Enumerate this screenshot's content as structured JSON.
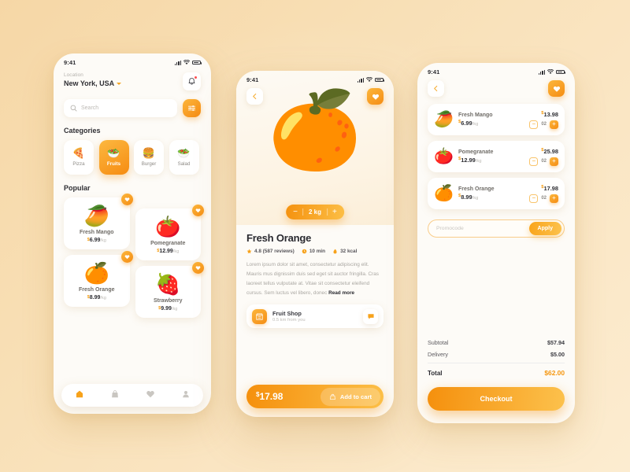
{
  "background": {
    "accent": "#f5960f",
    "page_bg": "#f8dfb5"
  },
  "status_bar": {
    "time": "9:41"
  },
  "home": {
    "location_label": "Location",
    "city": "New York, USA",
    "notification_icon": "bell-icon",
    "search": {
      "placeholder": "Search",
      "icon": "search-icon"
    },
    "filter_icon": "filter-icon",
    "categories_title": "Categories",
    "categories": [
      {
        "label": "Pizza",
        "emoji": "🍕",
        "active": false
      },
      {
        "label": "Fruits",
        "emoji": "🥗",
        "active": true
      },
      {
        "label": "Burger",
        "emoji": "🍔",
        "active": false
      },
      {
        "label": "Salad",
        "emoji": "🥗",
        "active": false
      }
    ],
    "popular_title": "Popular",
    "products": [
      {
        "name": "Fresh Mango",
        "price": "6.99",
        "currency": "$",
        "unit": "/kg",
        "emoji": "🥭"
      },
      {
        "name": "Pomegranate",
        "price": "12.99",
        "currency": "$",
        "unit": "/kg",
        "emoji": "🍅"
      },
      {
        "name": "Fresh Orange",
        "price": "8.99",
        "currency": "$",
        "unit": "/kg",
        "emoji": "🍊"
      },
      {
        "name": "Strawberry",
        "price": "9.99",
        "currency": "$",
        "unit": "/kg",
        "emoji": "🍓"
      }
    ],
    "tabs": [
      {
        "name": "home",
        "icon": "home-icon",
        "active": true
      },
      {
        "name": "bag",
        "icon": "bag-icon",
        "active": false
      },
      {
        "name": "favorites",
        "icon": "heart-icon",
        "active": false
      },
      {
        "name": "profile",
        "icon": "person-icon",
        "active": false
      }
    ]
  },
  "detail": {
    "back_icon": "chevron-left-icon",
    "favorite_icon": "heart-icon",
    "hero_emoji": "🍊",
    "quantity": {
      "minus": "−",
      "value": "2 kg",
      "plus": "+"
    },
    "title": "Fresh Orange",
    "meta": [
      {
        "icon": "star-icon",
        "text": "4.8 (587 reviews)"
      },
      {
        "icon": "clock-icon",
        "text": "10 min"
      },
      {
        "icon": "flame-icon",
        "text": "32 kcal"
      }
    ],
    "description": "Lorem ipsum dolor sit amet, consectetur adipiscing elit. Mauris mus dignissim duis sed eget sit auctor fringilla. Cras laoreet tellus vulputate at. Vitae sit consectetur eleifend cursus. Sem luctus vel libero, donec ",
    "read_more": "Read more",
    "shop": {
      "name": "Fruit Shop",
      "distance": "0.5 km from you",
      "icon": "store-icon",
      "chat_icon": "chat-icon"
    },
    "cta": {
      "currency": "$",
      "price": "17.98",
      "label": "Add to cart",
      "icon": "bag-icon"
    }
  },
  "cart": {
    "back_icon": "chevron-left-icon",
    "favorite_icon": "heart-icon",
    "items": [
      {
        "name": "Fresh Mango",
        "unit_price": "6.99",
        "unit": "/kg",
        "currency": "$",
        "total": "13.98",
        "qty": "02",
        "emoji": "🥭"
      },
      {
        "name": "Pomegranate",
        "unit_price": "12.99",
        "unit": "/kg",
        "currency": "$",
        "total": "25.98",
        "qty": "02",
        "emoji": "🍅"
      },
      {
        "name": "Fresh Orange",
        "unit_price": "8.99",
        "unit": "/kg",
        "currency": "$",
        "total": "17.98",
        "qty": "02",
        "emoji": "🍊"
      }
    ],
    "promocode": {
      "placeholder": "Promocode",
      "apply_label": "Apply"
    },
    "summary": {
      "subtotal_label": "Subtotal",
      "subtotal_value": "$57.94",
      "delivery_label": "Delivery",
      "delivery_value": "$5.00",
      "total_label": "Total",
      "total_value": "$62.00"
    },
    "checkout_label": "Checkout"
  }
}
